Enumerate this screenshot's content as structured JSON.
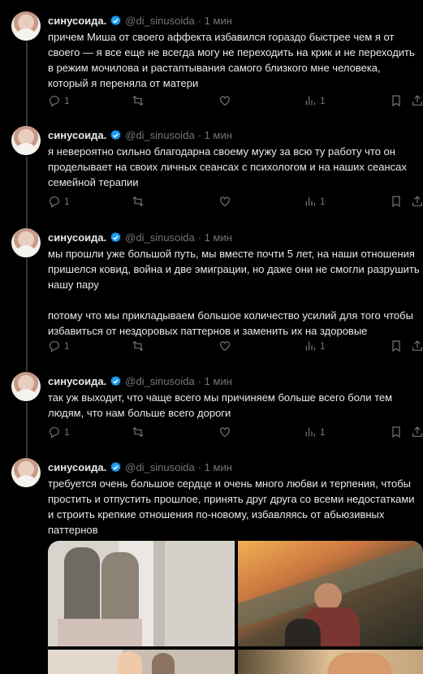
{
  "tweets": [
    {
      "name": "синусоида.",
      "handle": "@di_sinusoida",
      "time": "· 1 мин",
      "text": "причем Миша от своего аффекта избавился гораздо быстрее чем я от своего — я все еще не всегда могу не переходить на крик и не переходить в режим мочилова и растаптывания самого близкого мне человека, который я переняла от матери",
      "replies": "1",
      "views": "1"
    },
    {
      "name": "синусоида.",
      "handle": "@di_sinusoida",
      "time": "· 1 мин",
      "text": "я невероятно сильно благодарна своему мужу за всю ту работу что он проделывает на своих личных сеансах с психологом и на наших сеансах семейной терапии",
      "replies": "1",
      "views": "1"
    },
    {
      "name": "синусоида.",
      "handle": "@di_sinusoida",
      "time": "· 1 мин",
      "text": "мы прошли уже большой путь, мы вместе почти 5 лет, на наши отношения пришелся ковид, война и две эмиграции, но даже они не смогли разрушить нашу пару\n\nпотому что мы прикладываем большое количество усилий для того чтобы избавиться от нездоровых паттернов и заменить их на здоровые",
      "replies": "1",
      "views": "1"
    },
    {
      "name": "синусоида.",
      "handle": "@di_sinusoida",
      "time": "· 1 мин",
      "text": "так уж выходит, что чаще всего мы причиняем больше всего боли тем людям, что нам больше всего дороги",
      "replies": "1",
      "views": "1"
    },
    {
      "name": "синусоида.",
      "handle": "@di_sinusoida",
      "time": "· 1 мин",
      "text": "требуется очень большое сердце и очень много любви и терпения, чтобы простить и отпустить прошлое, принять друг друга со всеми недостатками и строить крепкие отношения по-новому, избавляясь от абьюзивных паттернов"
    }
  ],
  "colors": {
    "background": "#000000",
    "text": "#e7e9ea",
    "secondary": "#71767b",
    "verified": "#1d9bf0",
    "thread_line": "#333639"
  },
  "icons": [
    "reply-icon",
    "retweet-icon",
    "like-icon",
    "views-icon",
    "bookmark-icon",
    "share-icon",
    "verified-badge-icon"
  ]
}
